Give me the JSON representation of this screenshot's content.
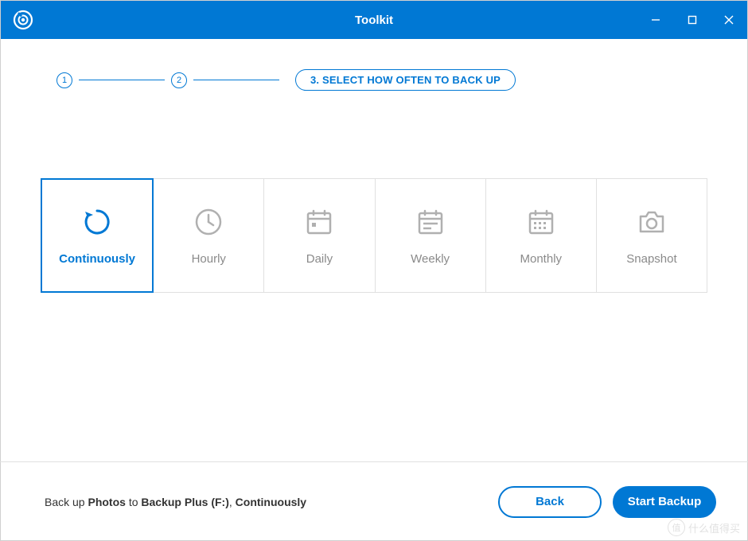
{
  "window": {
    "title": "Toolkit"
  },
  "stepper": {
    "step1": "1",
    "step2": "2",
    "step3_label": "3. SELECT HOW OFTEN TO BACK UP"
  },
  "options": {
    "continuously": "Continuously",
    "hourly": "Hourly",
    "daily": "Daily",
    "weekly": "Weekly",
    "monthly": "Monthly",
    "snapshot": "Snapshot",
    "selected": "continuously"
  },
  "summary": {
    "prefix": "Back up ",
    "source": "Photos",
    "mid": " to ",
    "destination": "Backup Plus (F:)",
    "sep": ", ",
    "frequency": "Continuously"
  },
  "buttons": {
    "back": "Back",
    "start": "Start Backup"
  },
  "watermark": {
    "badge": "值",
    "text": "什么值得买"
  },
  "colors": {
    "primary": "#0078d4",
    "muted": "#8a8a8a",
    "border": "#e0e0e0"
  }
}
